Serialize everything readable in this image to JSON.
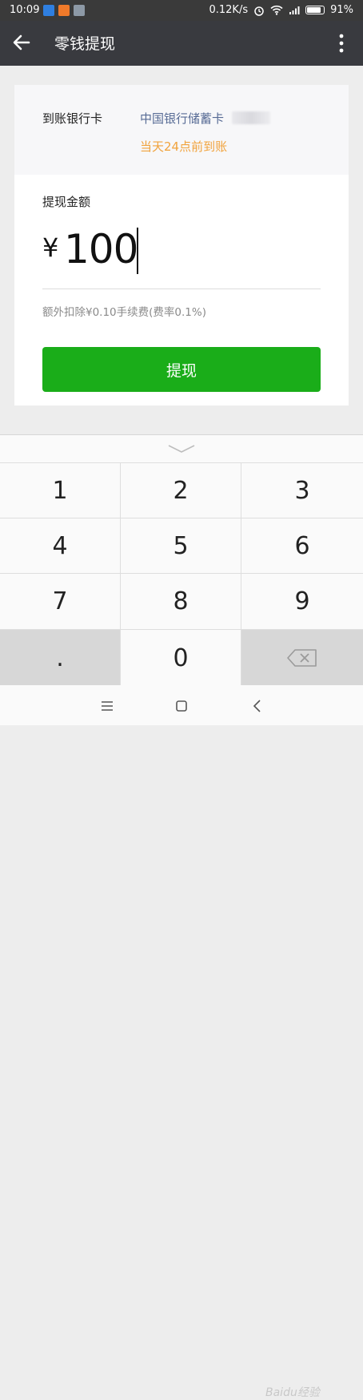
{
  "status_bar": {
    "time": "10:09",
    "network_speed": "0.12K/s",
    "battery": "91%",
    "battery_level": 0.91
  },
  "app_bar": {
    "title": "零钱提现"
  },
  "card": {
    "arrival_label": "到账银行卡",
    "bank_name": "中国银行储蓄卡",
    "arrival_time": "当天24点前到账",
    "amount_label": "提现金额",
    "currency_symbol": "¥",
    "amount": "100",
    "fee_note": "额外扣除¥0.10手续费(费率0.1%)",
    "withdraw_button": "提现"
  },
  "keypad": {
    "keys": [
      "1",
      "2",
      "3",
      "4",
      "5",
      "6",
      "7",
      "8",
      "9",
      ".",
      "0"
    ]
  },
  "watermark": "Baidu经验",
  "colors": {
    "primary_green": "#1aad19",
    "link_blue": "#576b95",
    "warning_orange": "#f1a33d",
    "app_bar": "#393a3f"
  }
}
